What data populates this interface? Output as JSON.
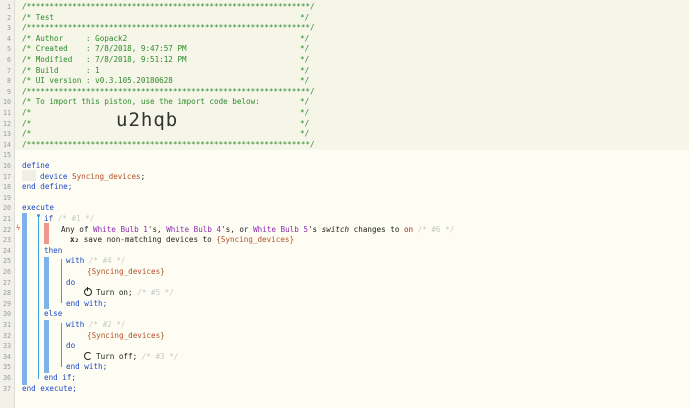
{
  "lines": {
    "l1": "/**************************************************************/",
    "l2a": "/* ",
    "l2b": "Test",
    "l2c": "*/",
    "l3": "/**************************************************************/",
    "l4a": "/* Author     : ",
    "l4b": "Gopack2",
    "l5a": "/* Created    : ",
    "l5b": "7/8/2018, 9:47:57 PM",
    "l6a": "/* Modified   : ",
    "l6b": "7/8/2018, 9:51:12 PM",
    "l7a": "/* Build      : ",
    "l7b": "1",
    "l8a": "/* UI version : ",
    "l8b": "v0.3.105.20180628",
    "l9": "/**************************************************************/",
    "l10": "/* To import this piston, use the import code below:",
    "l11": "/*",
    "l12": "/*",
    "l13": "/*",
    "l14": "/**************************************************************/",
    "close": "*/"
  },
  "import_code": "u2hqb",
  "code": {
    "define": "define",
    "device_kw": "device",
    "device_name": "Syncing_devices",
    "end_define": "end define;",
    "execute": "execute",
    "if_kw": "if",
    "if_id": "/* #1 */",
    "any_of": "Any of",
    "dev1": "White Bulb 1",
    "dev1_suffix": "'s, ",
    "dev2": "White Bulb 4",
    "dev2_suffix": "'s, or ",
    "dev3": "White Bulb 5",
    "dev3_suffix": "'s ",
    "attr": "switch",
    "changes_to": " changes to ",
    "val_on": "on",
    "cond_id": "/* #6 */",
    "x2": "x₂",
    "save_text": "save non-matching devices to",
    "save_var": "{Syncing_devices}",
    "then_kw": "then",
    "with_kw": "with",
    "with1_id": "/* #4 */",
    "with_var": "{Syncing_devices}",
    "do_kw": "do",
    "turn_on": "Turn on;",
    "turn_on_id": "/* #5 */",
    "end_with": "end with;",
    "else_kw": "else",
    "with2_id": "/* #2 */",
    "turn_off": "Turn off;",
    "turn_off_id": "/* #3 */",
    "end_if": "end if;",
    "end_execute": "end execute;"
  },
  "icons": {
    "trigger": "lightning-icon",
    "on": "power-icon",
    "off": "circle-arrow-icon"
  }
}
